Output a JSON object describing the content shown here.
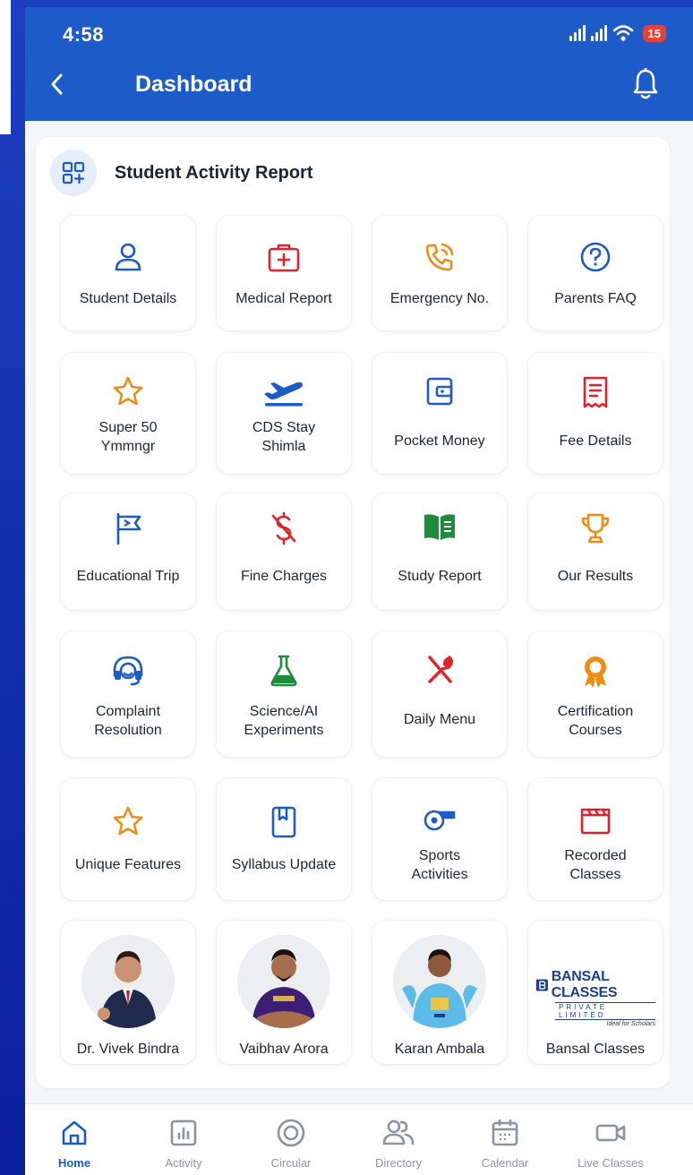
{
  "status_bar": {
    "time": "4:58",
    "battery": "15"
  },
  "header": {
    "title": "Dashboard"
  },
  "section": {
    "title": "Student Activity Report"
  },
  "tiles": [
    {
      "label": "Student Details",
      "icon": "user-icon",
      "color": "#1d5bc8"
    },
    {
      "label": "Medical Report",
      "icon": "first-aid-kit-icon",
      "color": "#e0232b"
    },
    {
      "label": "Emergency No.",
      "icon": "phone-call-icon",
      "color": "#f08b14"
    },
    {
      "label": "Parents FAQ",
      "icon": "question-circle-icon",
      "color": "#1d5bc8"
    },
    {
      "label": "Super 50\nYmmngr",
      "icon": "star-outline-icon",
      "color": "#f08b14"
    },
    {
      "label": "CDS Stay\nShimla",
      "icon": "airplane-takeoff-icon",
      "color": "#1d5bc8"
    },
    {
      "label": "Pocket Money",
      "icon": "wallet-icon",
      "color": "#1d5bc8"
    },
    {
      "label": "Fee Details",
      "icon": "receipt-icon",
      "color": "#e0232b"
    },
    {
      "label": "Educational Trip",
      "icon": "flag-icon",
      "color": "#1d5bc8"
    },
    {
      "label": "Fine Charges",
      "icon": "no-money-icon",
      "color": "#e0232b"
    },
    {
      "label": "Study Report",
      "icon": "open-book-icon",
      "color": "#1e8a3c"
    },
    {
      "label": "Our Results",
      "icon": "trophy-icon",
      "color": "#f08b14"
    },
    {
      "label": "Complaint\nResolution",
      "icon": "headset-icon",
      "color": "#1d5bc8"
    },
    {
      "label": "Science/AI\nExperiments",
      "icon": "flask-icon",
      "color": "#1e8a3c"
    },
    {
      "label": "Daily Menu",
      "icon": "fork-spoon-icon",
      "color": "#e0232b"
    },
    {
      "label": "Certification\nCourses",
      "icon": "award-badge-icon",
      "color": "#f08b14"
    },
    {
      "label": "Unique Features",
      "icon": "star-outline-icon",
      "color": "#f08b14"
    },
    {
      "label": "Syllabus Update",
      "icon": "bookmark-book-icon",
      "color": "#1d5bc8"
    },
    {
      "label": "Sports\nActivities",
      "icon": "whistle-icon",
      "color": "#1d5bc8"
    },
    {
      "label": "Recorded\nClasses",
      "icon": "clapperboard-icon",
      "color": "#e0232b"
    }
  ],
  "people": [
    {
      "label": "Dr. Vivek Bindra",
      "icon": "avatar-suit-photo"
    },
    {
      "label": "Vaibhav Arora",
      "icon": "avatar-cricketer-purple-photo"
    },
    {
      "label": "Karan Ambala",
      "icon": "avatar-cricketer-blue-photo"
    },
    {
      "label": "Bansal Classes",
      "icon": "bansal-classes-logo",
      "logo_main": "BANSAL CLASSES",
      "logo_sub": "PRIVATE LIMITED",
      "logo_tag": "Ideal for Scholars"
    }
  ],
  "nav": [
    {
      "label": "Home",
      "icon": "home-icon",
      "active": true
    },
    {
      "label": "Activity",
      "icon": "bar-chart-icon",
      "active": false
    },
    {
      "label": "Circular",
      "icon": "target-circle-icon",
      "active": false
    },
    {
      "label": "Directory",
      "icon": "users-icon",
      "active": false
    },
    {
      "label": "Calendar",
      "icon": "calendar-icon",
      "active": false
    },
    {
      "label": "Live Classes",
      "icon": "video-camera-icon",
      "active": false
    }
  ],
  "colors": {
    "primary": "#1d5bc8",
    "red": "#e0232b",
    "orange": "#f08b14",
    "green": "#1e8a3c",
    "nav_inactive": "#8d939e"
  }
}
